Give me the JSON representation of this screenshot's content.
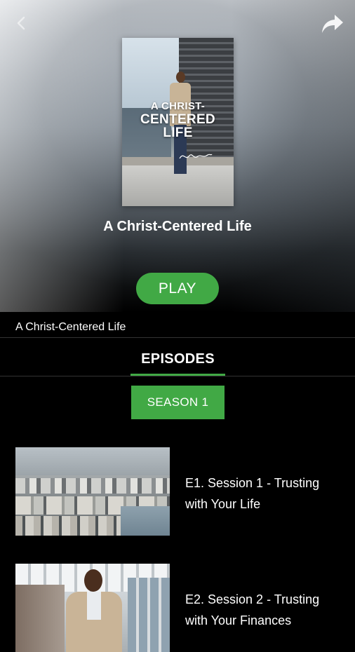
{
  "header": {
    "back_icon": "arrow-left-icon",
    "share_icon": "share-arrow-icon"
  },
  "poster": {
    "title_line1": "A CHRIST-",
    "title_line2": "CENTERED",
    "title_line3": "LIFE"
  },
  "hero": {
    "title": "A Christ-Centered Life",
    "play_label": "PLAY"
  },
  "description": "A Christ-Centered Life",
  "tabs": [
    {
      "label": "EPISODES",
      "active": true
    }
  ],
  "season": {
    "label": "SEASON 1"
  },
  "episodes": [
    {
      "title": "E1. Session 1 - Trusting with Your Life"
    },
    {
      "title": "E2. Session 2 - Trusting with Your Finances"
    }
  ],
  "colors": {
    "accent": "#41a945",
    "background": "#000000",
    "divider": "#333333"
  }
}
